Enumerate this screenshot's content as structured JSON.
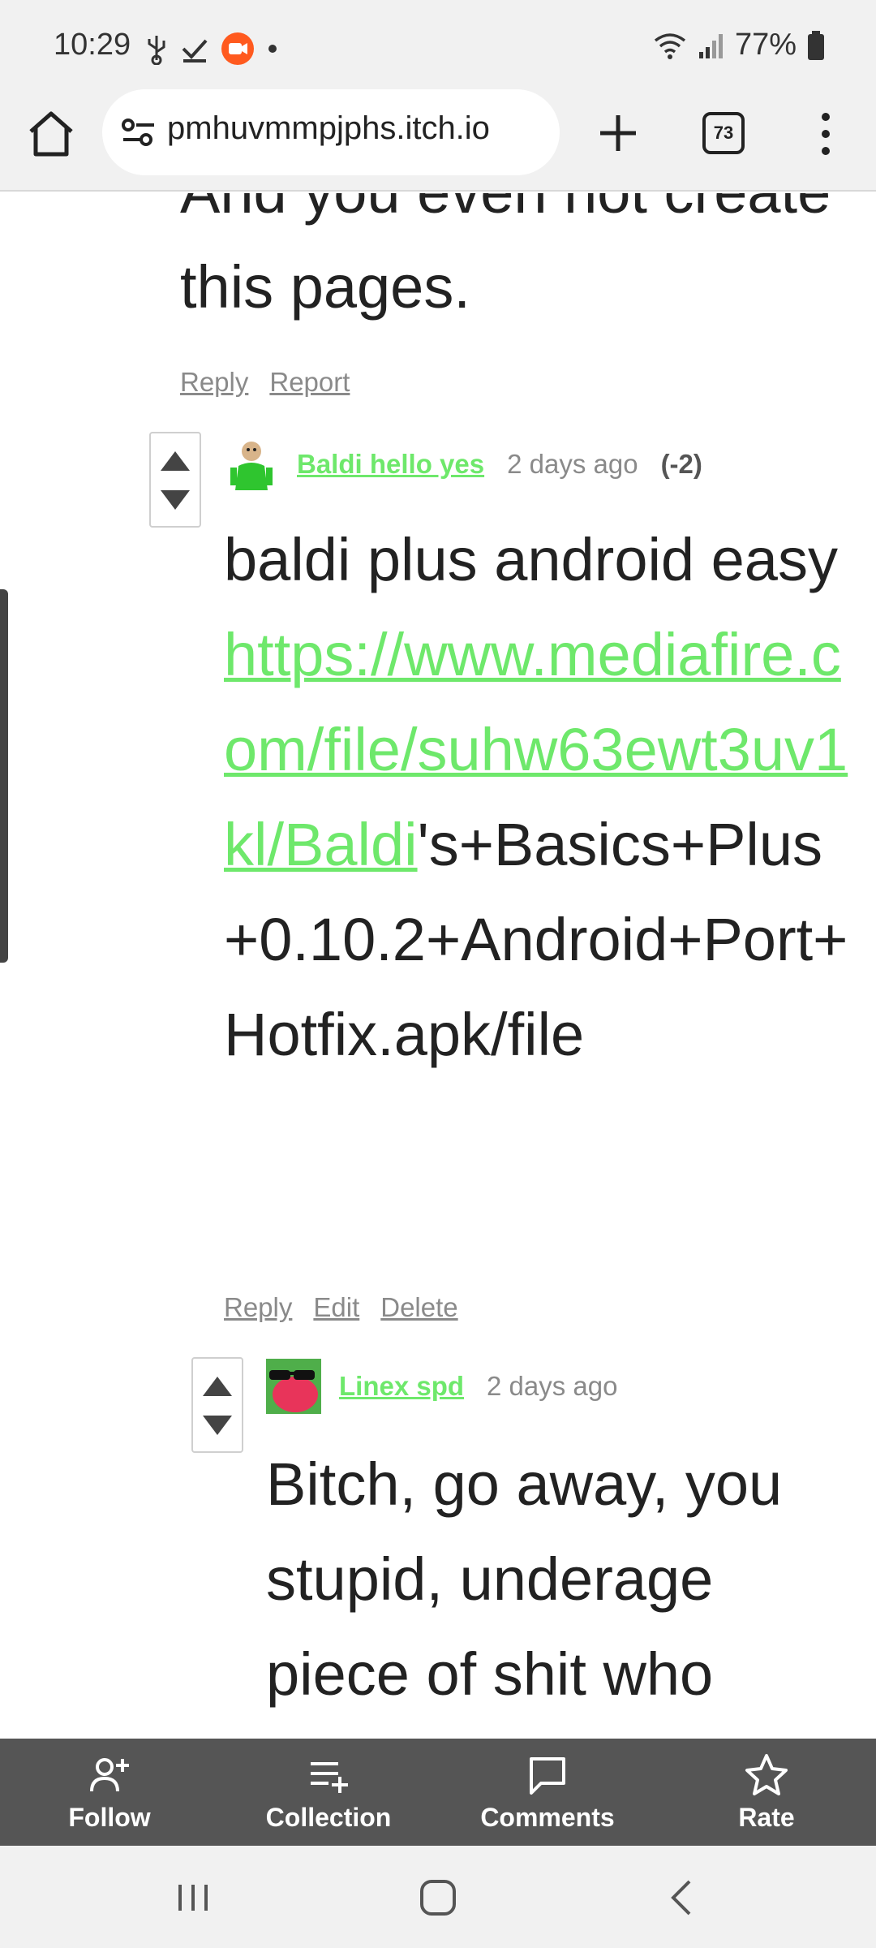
{
  "status_bar": {
    "time": "10:29",
    "battery": "77%",
    "icons": [
      "usb-icon",
      "check-icon",
      "recorder-icon",
      "dot-icon",
      "wifi-icon",
      "signal-icon",
      "battery-icon"
    ]
  },
  "browser": {
    "url": "pmhuvmmpjphs.itch.io",
    "tab_count": "73"
  },
  "comments": {
    "first": {
      "text": "And you even not create this pages.",
      "actions": [
        "Reply",
        "Report"
      ]
    },
    "second": {
      "author": "Baldi hello yes",
      "date": "2 days ago",
      "score": "(-2)",
      "text_before": "baldi plus android easy ",
      "link_text": "https://www.mediafire.com/file/suhw63ewt3uv1kl/Baldi",
      "text_after": "'s+Basics+Plus+0.10.2+Android+Port+Hotfix.apk/file",
      "actions": [
        "Reply",
        "Edit",
        "Delete"
      ]
    },
    "third": {
      "author": "Linex spd",
      "date": "2 days ago",
      "text": "Bitch, go away, you stupid, underage piece of shit who"
    }
  },
  "itch_bar": {
    "items": [
      {
        "label": "Follow",
        "icon": "follow-icon"
      },
      {
        "label": "Collection",
        "icon": "collection-icon"
      },
      {
        "label": "Comments",
        "icon": "comments-icon"
      },
      {
        "label": "Rate",
        "icon": "star-icon"
      }
    ]
  },
  "colors": {
    "link": "#6ee86b",
    "bar": "#555555",
    "muted": "#8a8a8a"
  }
}
